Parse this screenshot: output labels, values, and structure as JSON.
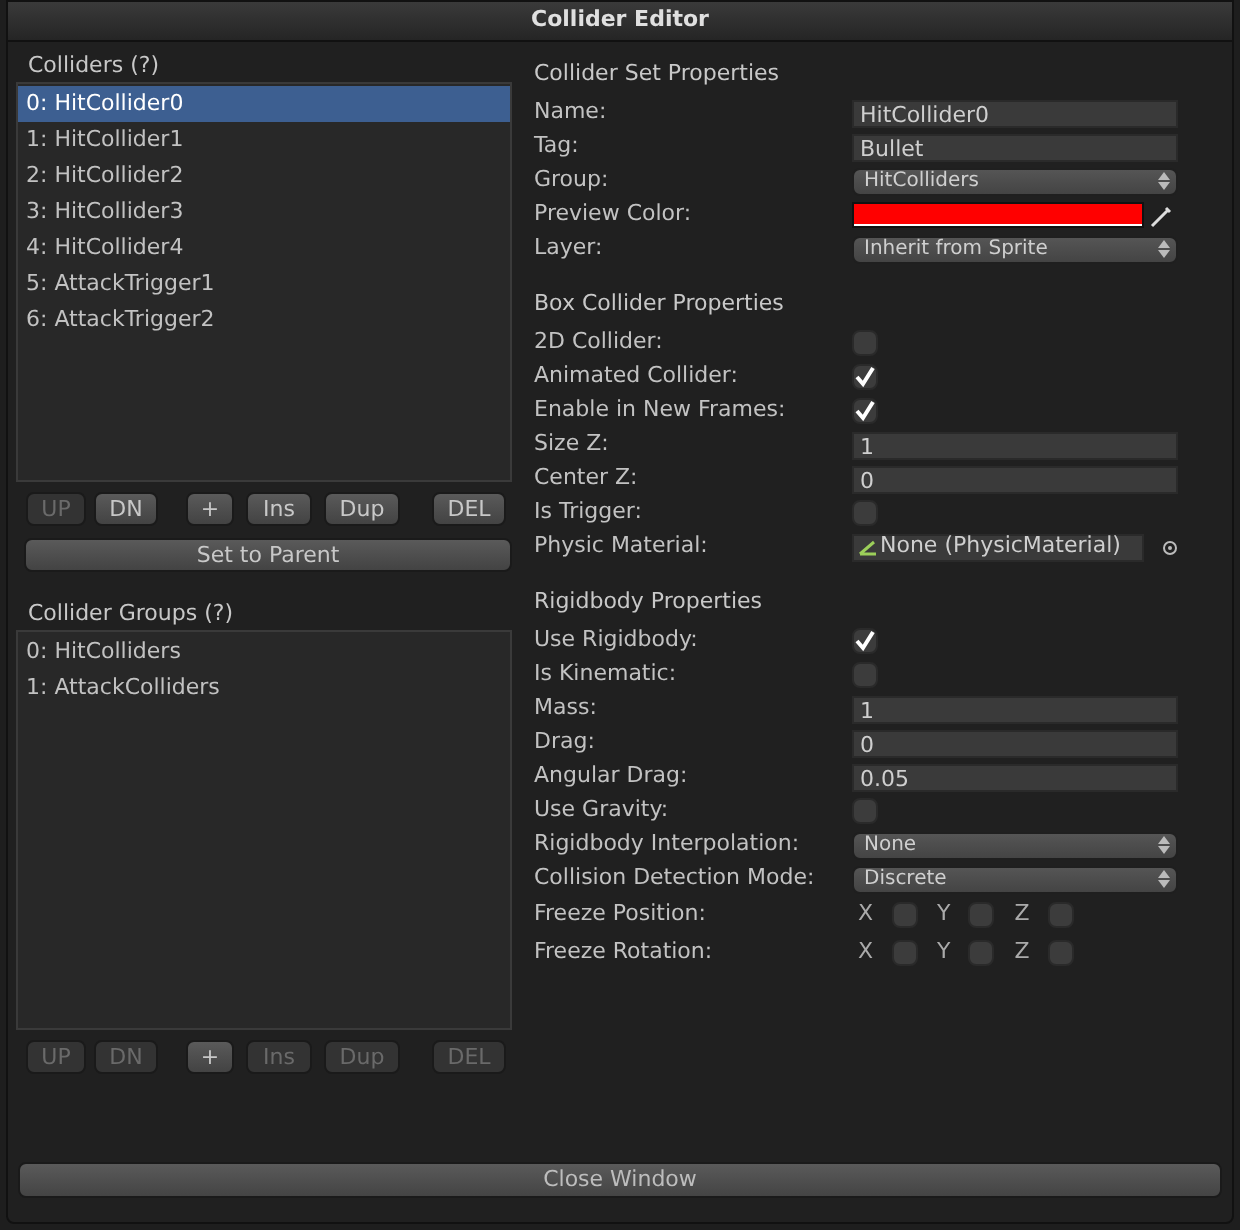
{
  "window": {
    "title": "Collider Editor"
  },
  "colliders": {
    "title": "Colliders (?)",
    "items": [
      {
        "label": "0: HitCollider0",
        "selected": true
      },
      {
        "label": "1: HitCollider1",
        "selected": false
      },
      {
        "label": "2: HitCollider2",
        "selected": false
      },
      {
        "label": "3: HitCollider3",
        "selected": false
      },
      {
        "label": "4: HitCollider4",
        "selected": false
      },
      {
        "label": "5: AttackTrigger1",
        "selected": false
      },
      {
        "label": "6: AttackTrigger2",
        "selected": false
      }
    ],
    "buttons": [
      {
        "label": "UP",
        "disabled": true
      },
      {
        "label": "DN",
        "disabled": false
      },
      {
        "label": "+",
        "disabled": false
      },
      {
        "label": "Ins",
        "disabled": false
      },
      {
        "label": "Dup",
        "disabled": false
      },
      {
        "label": "DEL",
        "disabled": false
      }
    ],
    "action": "Set to Parent"
  },
  "groups": {
    "title": "Collider Groups (?)",
    "items": [
      {
        "label": "0: HitColliders",
        "selected": false
      },
      {
        "label": "1: AttackColliders",
        "selected": false
      }
    ],
    "buttons": [
      {
        "label": "UP",
        "disabled": true
      },
      {
        "label": "DN",
        "disabled": true
      },
      {
        "label": "+",
        "disabled": false
      },
      {
        "label": "Ins",
        "disabled": true
      },
      {
        "label": "Dup",
        "disabled": true
      },
      {
        "label": "DEL",
        "disabled": true
      }
    ]
  },
  "sections": [
    {
      "title": "Collider Set Properties",
      "rows": [
        {
          "kind": "text",
          "label": "Name:",
          "value": "HitCollider0"
        },
        {
          "kind": "text",
          "label": "Tag:",
          "value": "Bullet"
        },
        {
          "kind": "dropdown",
          "label": "Group:",
          "value": "HitColliders"
        },
        {
          "kind": "color",
          "label": "Preview Color:",
          "color": "#ff0000"
        },
        {
          "kind": "dropdown",
          "label": "Layer:",
          "value": "Inherit from Sprite"
        }
      ]
    },
    {
      "title": "Box Collider Properties",
      "rows": [
        {
          "kind": "checkbox",
          "label": "2D Collider:",
          "checked": false
        },
        {
          "kind": "checkbox",
          "label": "Animated Collider:",
          "checked": true
        },
        {
          "kind": "checkbox",
          "label": "Enable in New Frames:",
          "checked": true
        },
        {
          "kind": "text",
          "label": "Size Z:",
          "value": "1"
        },
        {
          "kind": "text",
          "label": "Center Z:",
          "value": "0"
        },
        {
          "kind": "checkbox",
          "label": "Is Trigger:",
          "checked": false
        },
        {
          "kind": "object",
          "label": "Physic Material:",
          "value": "None (PhysicMaterial)"
        }
      ]
    },
    {
      "title": "Rigidbody Properties",
      "rows": [
        {
          "kind": "checkbox",
          "label": "Use Rigidbody:",
          "checked": true
        },
        {
          "kind": "checkbox",
          "label": "Is Kinematic:",
          "checked": false
        },
        {
          "kind": "text",
          "label": "Mass:",
          "value": "1"
        },
        {
          "kind": "text",
          "label": "Drag:",
          "value": "0"
        },
        {
          "kind": "text",
          "label": "Angular Drag:",
          "value": "0.05"
        },
        {
          "kind": "checkbox",
          "label": "Use Gravity:",
          "checked": false
        },
        {
          "kind": "dropdown",
          "label": "Rigidbody Interpolation:",
          "value": "None"
        },
        {
          "kind": "dropdown",
          "label": "Collision Detection Mode:",
          "value": "Discrete"
        },
        {
          "kind": "axes",
          "label": "Freeze Position:",
          "axes": [
            {
              "label": "X",
              "checked": false
            },
            {
              "label": "Y",
              "checked": false
            },
            {
              "label": "Z",
              "checked": false
            }
          ]
        },
        {
          "kind": "axes",
          "label": "Freeze Rotation:",
          "axes": [
            {
              "label": "X",
              "checked": false
            },
            {
              "label": "Y",
              "checked": false
            },
            {
              "label": "Z",
              "checked": false
            }
          ]
        }
      ]
    }
  ],
  "close_button": "Close Window"
}
